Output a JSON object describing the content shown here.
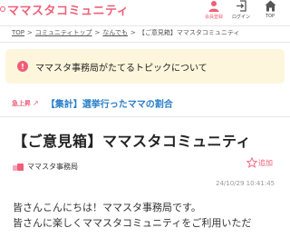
{
  "header": {
    "logo_text": "ママスタコミュニティ",
    "register_label": "会員登録",
    "login_label": "ログイン",
    "top_label": "TOP"
  },
  "breadcrumb": {
    "items": [
      "TOP",
      "コミュニティトップ",
      "なんでも",
      "【ご意見箱】ママスタコミュニティ"
    ]
  },
  "notice": {
    "icon": "!",
    "text": "ママスタ事務局がたてるトピックについて"
  },
  "rising": {
    "badge": "急上昇",
    "topic": "【集計】選挙行ったママの割合"
  },
  "topic": {
    "title": "【ご意見箱】ママスタコミュニティ",
    "author": "ママスタ事務局",
    "favorite_label": "追加",
    "timestamp": "24/10/29 10:41:45",
    "body_lines": [
      "皆さんこんにちは！ママスタ事務局です。",
      "皆さんに楽しくママスタコミュニティをご利用いただ"
    ]
  },
  "colors": {
    "accent": "#ef5f79",
    "link": "#2a7fc9",
    "notice_bg": "#fdf6dc"
  }
}
